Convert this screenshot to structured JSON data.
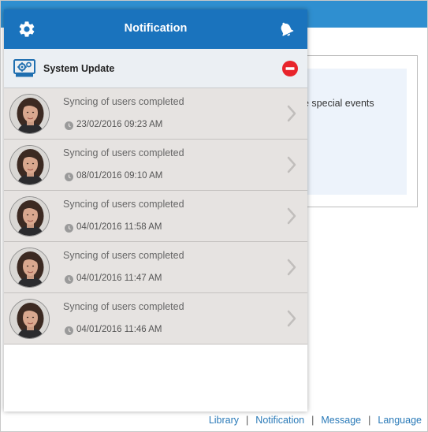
{
  "panel": {
    "title": "Notification",
    "system_update_label": "System Update"
  },
  "notifications": [
    {
      "message": "Syncing of users completed",
      "date": "23/02/2016 09:23 AM"
    },
    {
      "message": "Syncing of users completed",
      "date": "08/01/2016 09:10 AM"
    },
    {
      "message": "Syncing of users completed",
      "date": "04/01/2016 11:58 AM"
    },
    {
      "message": "Syncing of users completed",
      "date": "04/01/2016 11:47 AM"
    },
    {
      "message": "Syncing of users completed",
      "date": "04/01/2016 11:46 AM"
    }
  ],
  "background": {
    "card_text": "e special events"
  },
  "footer": {
    "links": [
      "Library",
      "Notification",
      "Message",
      "Language"
    ],
    "separator": "|"
  },
  "icons": {
    "header_left": "gear-icon",
    "header_right": "bell-icon",
    "system_update": "monitor-settings-icon",
    "remove": "remove-icon",
    "time": "clock-icon",
    "item_action": "chevron-right-icon"
  },
  "colors": {
    "topbar": "#2f8fd0",
    "panel_header": "#1a73bd",
    "remove": "#e8242b",
    "link": "#2a7ab8",
    "item_bg": "#e6e3e1",
    "system_row_bg": "#ebeff3"
  }
}
